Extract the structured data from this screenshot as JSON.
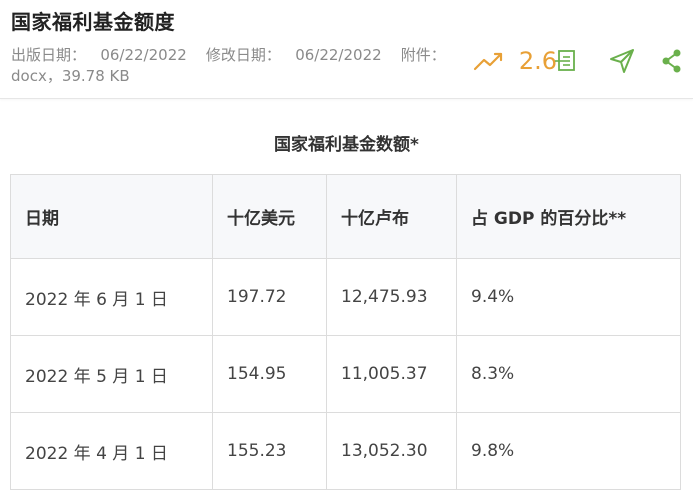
{
  "title": "国家福利基金额度",
  "meta": {
    "publish_label": "出版日期：",
    "publish_date": "06/22/2022",
    "modify_label": "修改日期：",
    "modify_date": "06/22/2022",
    "attach_label": "附件：",
    "attach_value": "docx，39.78 KB"
  },
  "actions": {
    "score": "2.6",
    "icons": [
      "trend-icon",
      "document-icon",
      "send-icon",
      "share-icon"
    ],
    "accent_color": "#e8a036",
    "green_color": "#6ab04c"
  },
  "table": {
    "title": "国家福利基金数额*",
    "headers": [
      "日期",
      "十亿美元",
      "十亿卢布",
      "占 GDP 的百分比**"
    ],
    "rows": [
      [
        "2022 年 6 月 1 日",
        "197.72",
        "12,475.93",
        "9.4%"
      ],
      [
        "2022 年 5 月 1 日",
        "154.95",
        "11,005.37",
        "8.3%"
      ],
      [
        "2022 年 4 月 1 日",
        "155.23",
        "13,052.30",
        "9.8%"
      ]
    ]
  }
}
